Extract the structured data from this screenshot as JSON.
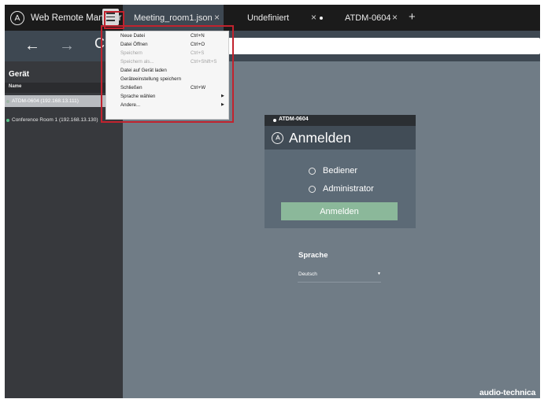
{
  "app": {
    "title": "Web Remote Manager",
    "logo_icon": "audio-technica-logo-icon"
  },
  "menu_button": {
    "icon": "hamburger-icon"
  },
  "tabs": [
    {
      "label": "Meeting_room1.json",
      "close": "×",
      "active": true,
      "modified": false
    },
    {
      "label": "Undefiniert",
      "close": "×",
      "active": false,
      "modified": true
    },
    {
      "label": "ATDM-0604",
      "close": "×",
      "active": false,
      "modified": false
    }
  ],
  "new_tab": "+",
  "nav": {
    "back": "←",
    "forward": "→",
    "reload": "C",
    "address_value": ""
  },
  "sidebar": {
    "heading": "Gerät",
    "column_header": "Name",
    "items": [
      {
        "label": "ATDM-0604 (192.168.13.111)",
        "selected": true,
        "status_color": "#9fb7a6"
      },
      {
        "label": "Conference Room 1 (192.168.13.130)",
        "selected": false,
        "status_color": "#5cc48a"
      }
    ]
  },
  "file_menu": {
    "items": [
      {
        "label": "Neue Datei",
        "shortcut": "Ctrl+N",
        "enabled": true,
        "submenu": false
      },
      {
        "label": "Datei Öffnen",
        "shortcut": "Ctrl+O",
        "enabled": true,
        "submenu": false
      },
      {
        "label": "Speichern",
        "shortcut": "Ctrl+S",
        "enabled": false,
        "submenu": false
      },
      {
        "label": "Speichern als...",
        "shortcut": "Ctrl+Shift+S",
        "enabled": false,
        "submenu": false
      },
      {
        "label": "Datei auf Gerät laden",
        "shortcut": "",
        "enabled": true,
        "submenu": false
      },
      {
        "label": "Geräteeinstellung speichern",
        "shortcut": "",
        "enabled": true,
        "submenu": false
      },
      {
        "label": "Schließen",
        "shortcut": "Ctrl+W",
        "enabled": true,
        "submenu": false
      },
      {
        "label": "Sprache wählen",
        "shortcut": "",
        "enabled": true,
        "submenu": true
      },
      {
        "label": "Andere...",
        "shortcut": "",
        "enabled": true,
        "submenu": true
      }
    ],
    "highlight_color": "#c1232e"
  },
  "login": {
    "device": "ATDM-0604",
    "title": "Anmelden",
    "options": [
      "Bediener",
      "Administrator"
    ],
    "button": "Anmelden",
    "button_color": "#8bb89a"
  },
  "language": {
    "title": "Sprache",
    "value": "Deutsch"
  },
  "brand": "audio-technica"
}
